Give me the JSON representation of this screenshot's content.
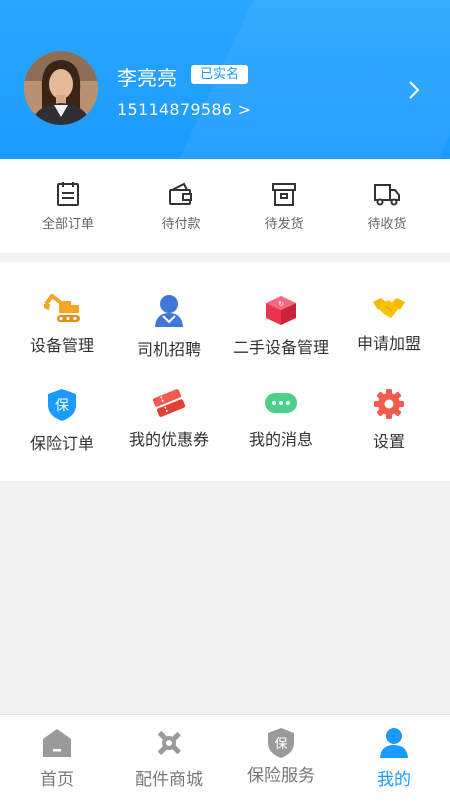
{
  "profile": {
    "name": "李亮亮",
    "verified_badge": "已实名",
    "phone": "15114879586 >",
    "avatar_icon": "user-photo"
  },
  "orders": [
    {
      "label": "全部订单",
      "icon": "clipboard-icon"
    },
    {
      "label": "待付款",
      "icon": "wallet-icon"
    },
    {
      "label": "待发货",
      "icon": "box-icon"
    },
    {
      "label": "待收货",
      "icon": "truck-icon"
    }
  ],
  "services": [
    {
      "label": "设备管理",
      "icon": "excavator-icon",
      "color": "#f5a623"
    },
    {
      "label": "司机招聘",
      "icon": "driver-icon",
      "color": "#3f78d8"
    },
    {
      "label": "二手设备管理",
      "icon": "package-icon",
      "color": "#e8344e"
    },
    {
      "label": "申请加盟",
      "icon": "handshake-icon",
      "color": "#f5b800"
    },
    {
      "label": "保险订单",
      "icon": "shield-icon",
      "color": "#1a9bff"
    },
    {
      "label": "我的优惠券",
      "icon": "ticket-icon",
      "color": "#f05a4f"
    },
    {
      "label": "我的消息",
      "icon": "chat-icon",
      "color": "#4cd08a"
    },
    {
      "label": "设置",
      "icon": "gear-icon",
      "color": "#f05a4f"
    }
  ],
  "tabs": [
    {
      "label": "首页",
      "icon": "home-icon",
      "active": false
    },
    {
      "label": "配件商城",
      "icon": "tools-icon",
      "active": false
    },
    {
      "label": "保险服务",
      "icon": "insurance-icon",
      "active": false
    },
    {
      "label": "我的",
      "icon": "profile-icon",
      "active": true
    }
  ],
  "colors": {
    "accent": "#1a9bff",
    "tab_inactive": "#777777",
    "icon_gray": "#9a9a9a"
  }
}
